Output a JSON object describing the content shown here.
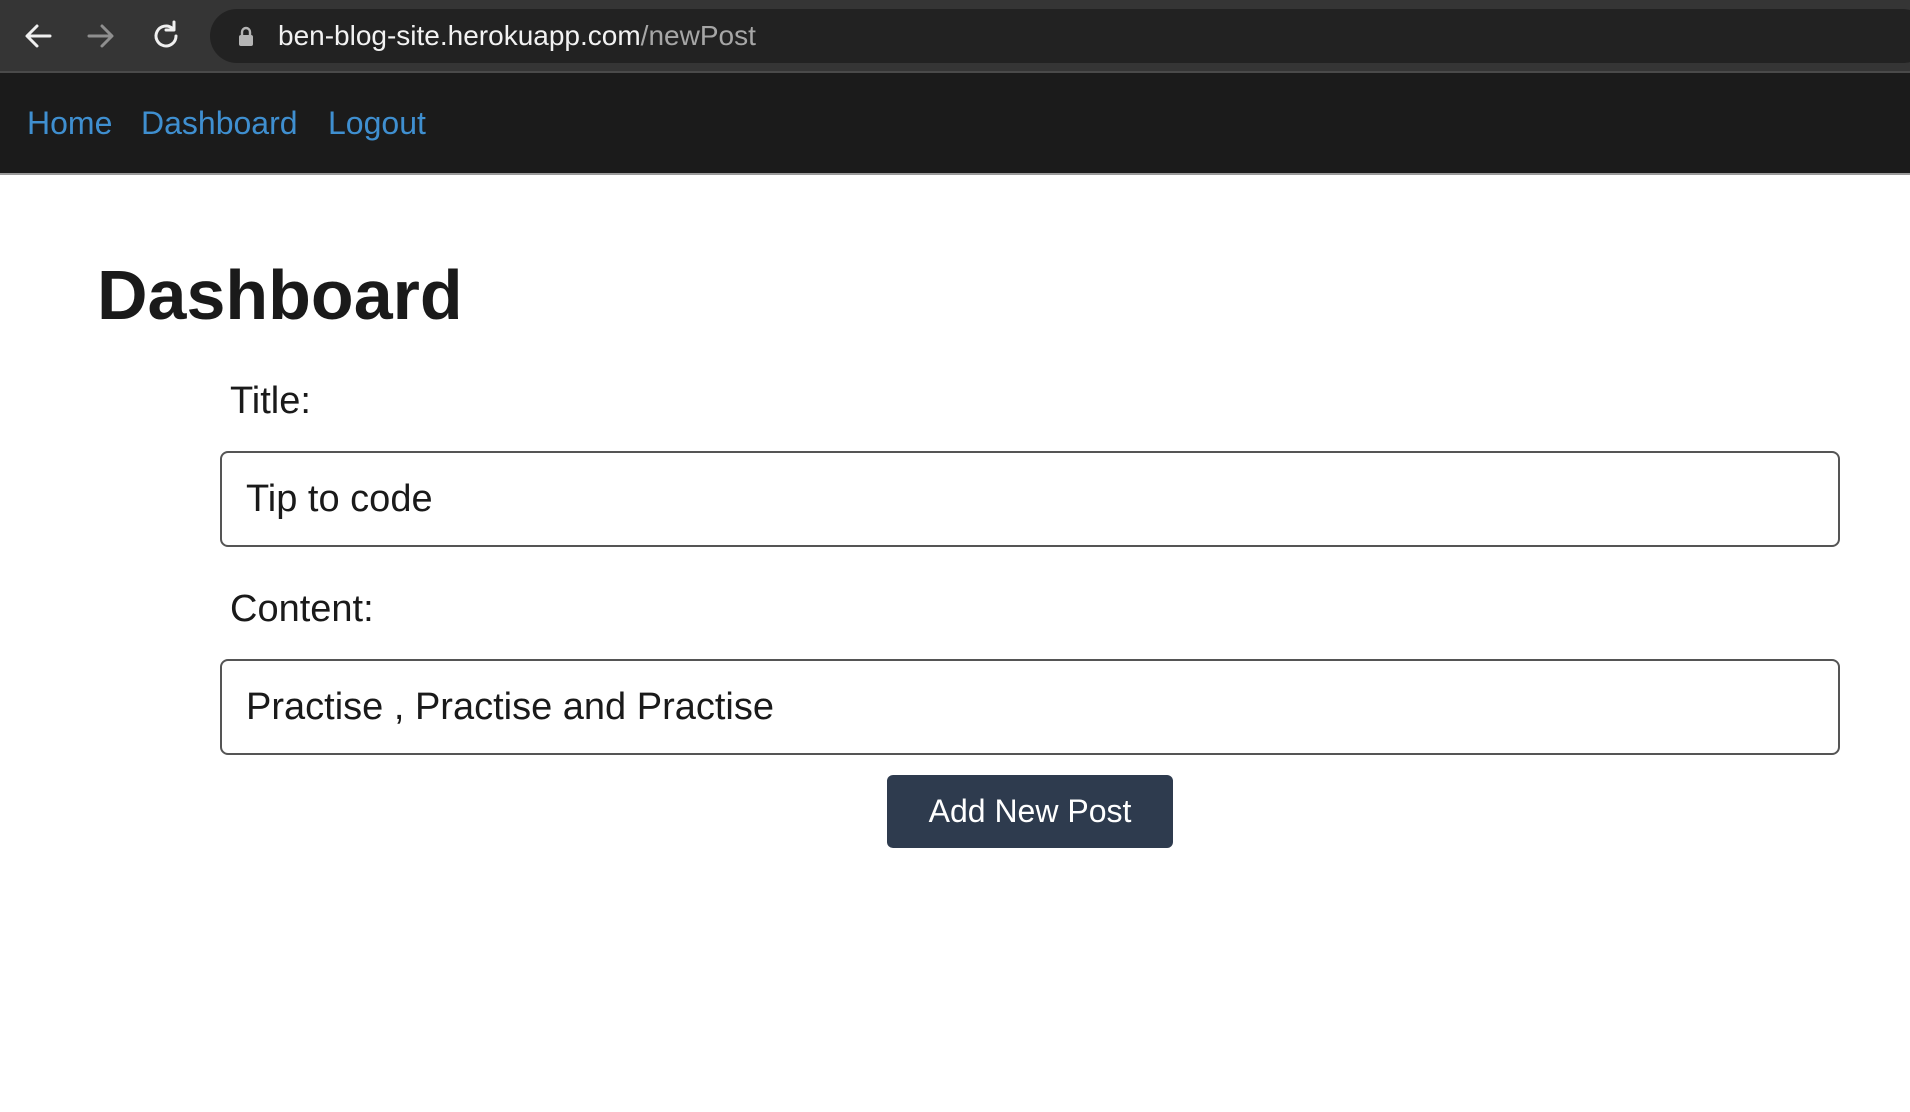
{
  "browser": {
    "url_host": "ben-blog-site.herokuapp.com",
    "url_path": "/newPost"
  },
  "nav": {
    "links": [
      {
        "label": "Home"
      },
      {
        "label": "Dashboard"
      },
      {
        "label": "Logout"
      }
    ],
    "link_color": "#3f8fd0",
    "background": "#1b1b1b"
  },
  "page": {
    "title": "Dashboard"
  },
  "form": {
    "title_label": "Title:",
    "title_value": "Tip to code",
    "content_label": "Content:",
    "content_value": "Practise , Practise and Practise",
    "submit_label": "Add New Post",
    "submit_color": "#2e3b4e"
  },
  "icons": [
    "back-arrow-icon",
    "forward-arrow-icon",
    "reload-icon",
    "lock-icon"
  ]
}
